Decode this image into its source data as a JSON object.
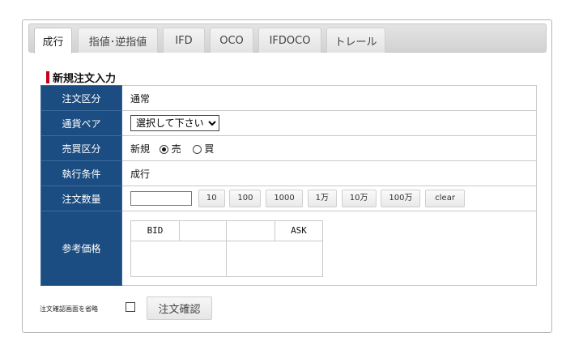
{
  "tabs": [
    {
      "label": "成行",
      "active": true
    },
    {
      "label": "指値･逆指値",
      "active": false
    },
    {
      "label": "IFD",
      "active": false
    },
    {
      "label": "OCO",
      "active": false
    },
    {
      "label": "IFDOCO",
      "active": false
    },
    {
      "label": "トレール",
      "active": false
    }
  ],
  "section_title": "新規注文入力",
  "rows": {
    "order_type": {
      "label": "注文区分",
      "value": "通常"
    },
    "pair": {
      "label": "通貨ペア",
      "selected": "選択して下さい"
    },
    "side": {
      "label": "売買区分",
      "prefix": "新規",
      "sell": "売",
      "buy": "買",
      "selected": "売"
    },
    "exec": {
      "label": "執行条件",
      "value": "成行"
    },
    "qty": {
      "label": "注文数量",
      "value": "",
      "buttons": [
        "10",
        "100",
        "1000",
        "1万",
        "10万",
        "100万",
        "clear"
      ]
    },
    "ref": {
      "label": "参考価格",
      "bid": "BID",
      "ask": "ASK"
    }
  },
  "footer": {
    "skip_label": "注文確認画面を省略",
    "confirm_button": "注文確認"
  },
  "colors": {
    "label_bg": "#1b4d82",
    "accent": "#c6001c"
  }
}
